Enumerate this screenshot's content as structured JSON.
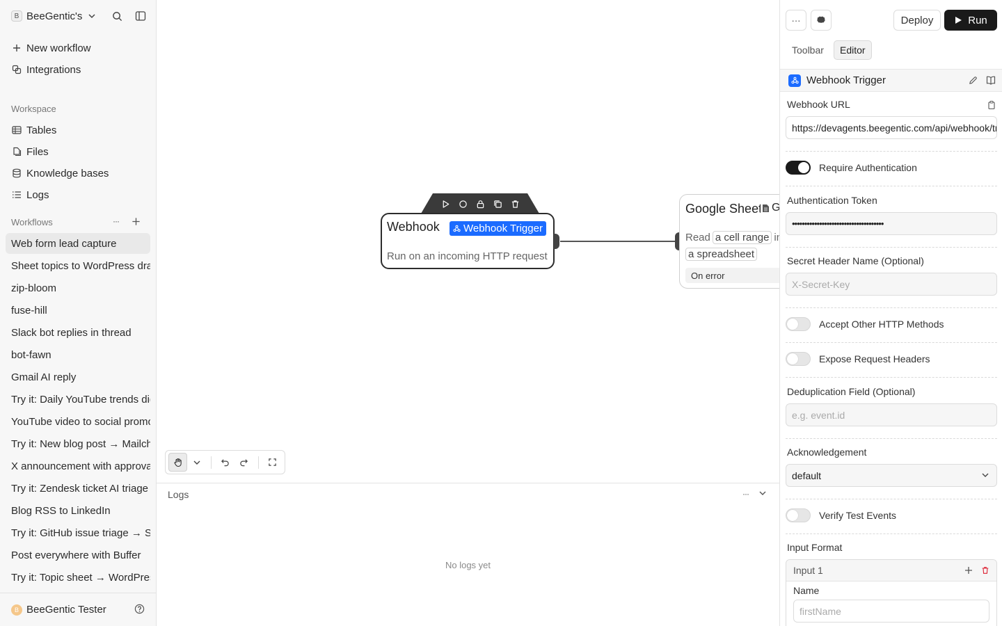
{
  "sidebar": {
    "workspace": {
      "badge": "B",
      "name": "BeeGentic's"
    },
    "top_items": [
      {
        "label": "New workflow",
        "icon": "plus-icon"
      },
      {
        "label": "Integrations",
        "icon": "integrations-icon"
      }
    ],
    "workspace_label": "Workspace",
    "workspace_items": [
      {
        "label": "Tables",
        "icon": "table-icon"
      },
      {
        "label": "Files",
        "icon": "files-icon"
      },
      {
        "label": "Knowledge bases",
        "icon": "database-icon"
      },
      {
        "label": "Logs",
        "icon": "list-icon"
      }
    ],
    "workflows_label": "Workflows",
    "workflows": [
      "Web form lead capture",
      "Sheet topics to WordPress drafts",
      "zip-bloom",
      "fuse-hill",
      "Slack bot replies in thread",
      "bot-fawn",
      "Gmail AI reply",
      "Try it: Daily YouTube trends digest",
      "YouTube video to social promo",
      "Try it: New blog post → Mailchimp",
      "X announcement with approval",
      "Try it: Zendesk ticket AI triage",
      "Blog RSS to LinkedIn",
      "Try it: GitHub issue triage → Slack",
      "Post everywhere with Buffer",
      "Try it: Topic sheet → WordPress"
    ],
    "active_workflow": "Web form lead capture",
    "user": {
      "avatar": "B",
      "name": "BeeGentic Tester"
    }
  },
  "canvas": {
    "webhook_node": {
      "title": "Webhook",
      "tag": "Webhook Trigger",
      "subtitle": "Run on an incoming HTTP request"
    },
    "sheets_node": {
      "title": "Google Sheets",
      "trail": "G",
      "read_word": "Read",
      "chip1": "a cell range",
      "chip1_after": "in",
      "chip2": "a spreadsheet",
      "error_label": "On error"
    }
  },
  "logs": {
    "title": "Logs",
    "empty": "No logs yet"
  },
  "panel": {
    "more_label": "···",
    "deploy_label": "Deploy",
    "run_label": "Run",
    "tabs": [
      {
        "label": "Toolbar",
        "active": false
      },
      {
        "label": "Editor",
        "active": true
      }
    ],
    "block_name": "Webhook Trigger",
    "webhook_url_label": "Webhook URL",
    "webhook_url": "https://devagents.beegentic.com/api/webhook/trigger",
    "require_auth_label": "Require Authentication",
    "auth_token_label": "Authentication Token",
    "auth_token": "•••••••••••••••••••••••••••••••••••••",
    "secret_header_label": "Secret Header Name (Optional)",
    "secret_header_placeholder": "X-Secret-Key",
    "accept_methods_label": "Accept Other HTTP Methods",
    "expose_headers_label": "Expose Request Headers",
    "dedup_label": "Deduplication Field (Optional)",
    "dedup_placeholder": "e.g. event.id",
    "ack_label": "Acknowledgement",
    "ack_value": "default",
    "verify_label": "Verify Test Events",
    "input_format_label": "Input Format",
    "input_name": "Input 1",
    "input_field_label": "Name",
    "input_field_placeholder": "firstName"
  },
  "colors": {
    "accent": "#1b6bff",
    "run_bg": "#1a1a1a"
  }
}
